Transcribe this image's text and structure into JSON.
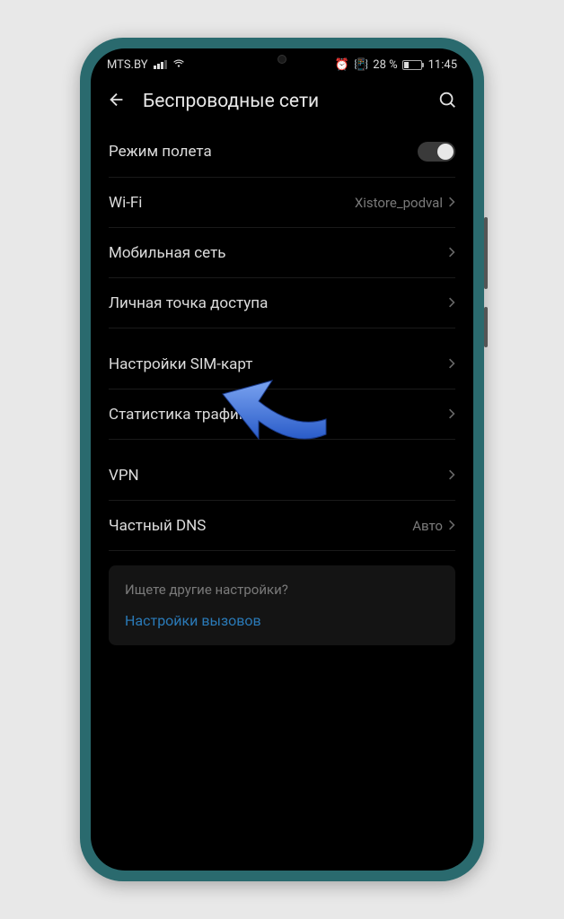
{
  "status_bar": {
    "carrier": "MTS.BY",
    "alarm_icon": "alarm-icon",
    "vibrate_icon": "vibrate-icon",
    "battery_percent": "28 %",
    "time": "11:45"
  },
  "header": {
    "title": "Беспроводные сети"
  },
  "settings": {
    "airplane": {
      "label": "Режим полета",
      "toggle": false
    },
    "wifi": {
      "label": "Wi-Fi",
      "value": "Xistore_podval"
    },
    "mobile": {
      "label": "Мобильная сеть"
    },
    "hotspot": {
      "label": "Личная точка доступа"
    },
    "sim": {
      "label": "Настройки SIM-карт"
    },
    "traffic": {
      "label": "Статистика трафика"
    },
    "vpn": {
      "label": "VPN"
    },
    "dns": {
      "label": "Частный DNS",
      "value": "Авто"
    }
  },
  "hint": {
    "title": "Ищете другие настройки?",
    "link": "Настройки вызовов"
  }
}
